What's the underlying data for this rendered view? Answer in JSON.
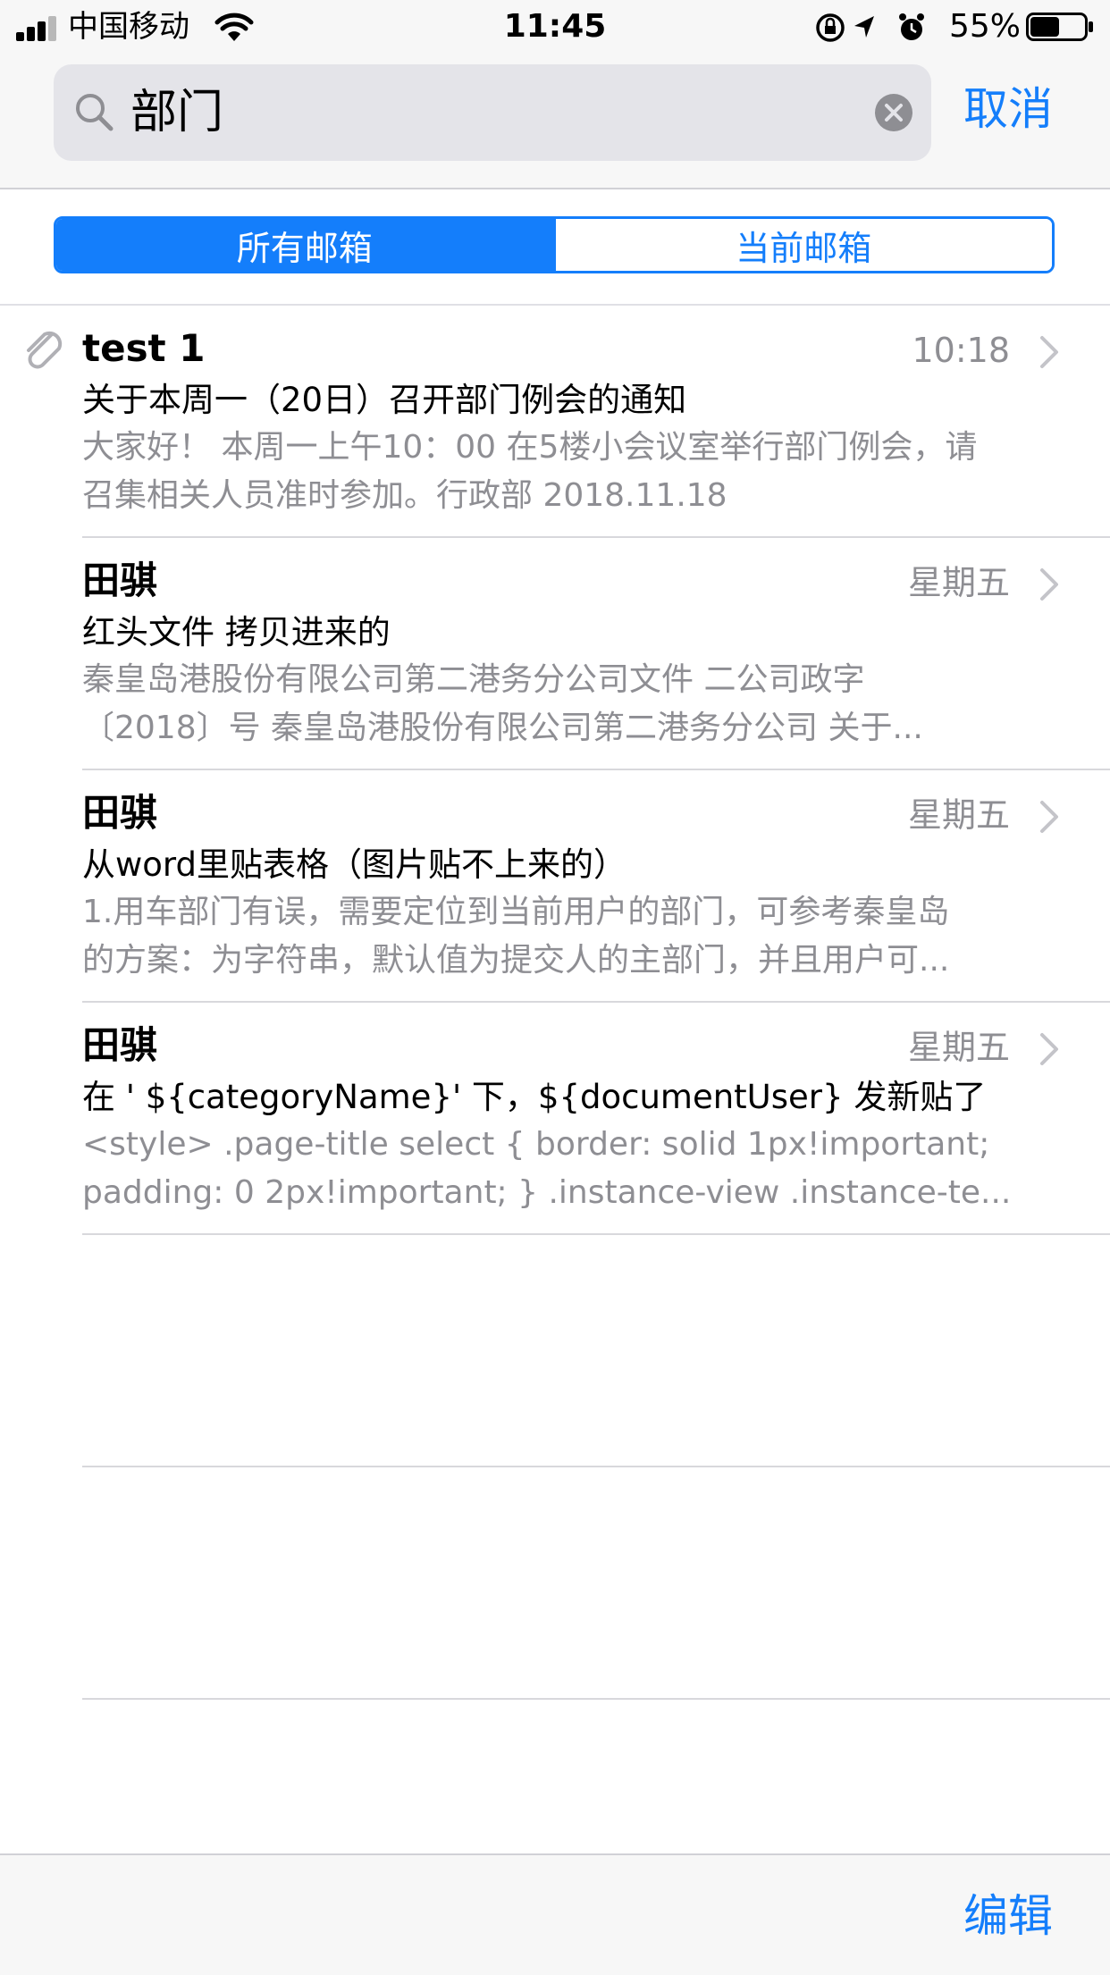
{
  "status_bar": {
    "carrier": "中国移动",
    "time": "11:45",
    "battery_percent": "55%",
    "battery_level": 0.55,
    "signal_bars": 3
  },
  "search": {
    "query": "部门",
    "cancel_label": "取消"
  },
  "scope_tabs": {
    "all_label": "所有邮箱",
    "current_label": "当前邮箱",
    "selected": "all"
  },
  "messages": [
    {
      "sender": "test 1",
      "time": "10:18",
      "has_attachment": true,
      "subject": "关于本周一（20日）召开部门例会的通知",
      "preview_line1": "大家好！ 本周一上午10：00 在5楼小会议室举行部门例会，请",
      "preview_line2": "召集相关人员准时参加。行政部   2018.11.18"
    },
    {
      "sender": "田骐",
      "time": "星期五",
      "has_attachment": false,
      "subject": "红头文件  拷贝进来的",
      "preview_line1": "秦皇岛港股份有限公司第二港务分公司文件 二公司政字",
      "preview_line2": "〔2018〕号     秦皇岛港股份有限公司第二港务分公司 关于..."
    },
    {
      "sender": "田骐",
      "time": "星期五",
      "has_attachment": false,
      "subject": "从word里贴表格（图片贴不上来的）",
      "preview_line1": "1.用车部门有误，需要定位到当前用户的部门，可参考秦皇岛",
      "preview_line2": "的方案：为字符串，默认值为提交人的主部门，并且用户可..."
    },
    {
      "sender": "田骐",
      "time": "星期五",
      "has_attachment": false,
      "subject": "在 ' ${categoryName}' 下，${documentUser}  发新贴了",
      "preview_line1": "<style> .page-title select {     border: solid 1px!important;",
      "preview_line2": "padding: 0 2px!important; }     .instance-view .instance-te..."
    }
  ],
  "toolbar": {
    "edit_label": "编辑"
  },
  "colors": {
    "accent": "#147efb",
    "secondary_text": "#8e8e93",
    "bar_background": "#f7f7f7"
  }
}
